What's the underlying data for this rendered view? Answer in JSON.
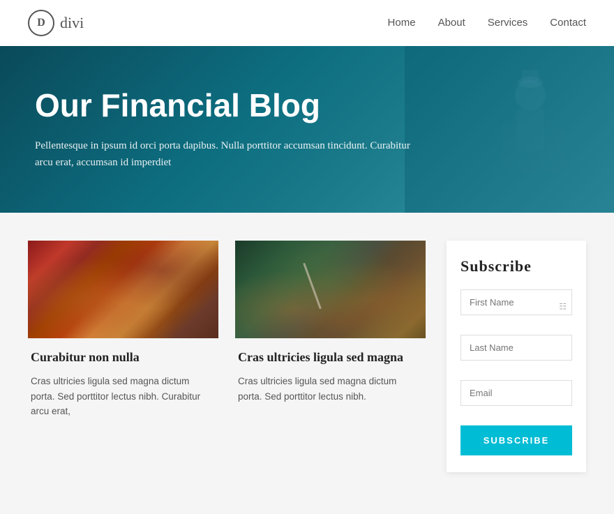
{
  "nav": {
    "logo_letter": "D",
    "logo_name": "divi",
    "links": [
      "Home",
      "About",
      "Services",
      "Contact"
    ]
  },
  "hero": {
    "title": "Our Financial Blog",
    "subtitle": "Pellentesque in ipsum id orci porta dapibus. Nulla porttitor accumsan tincidunt. Curabitur arcu erat, accumsan id imperdiet"
  },
  "posts": [
    {
      "id": 1,
      "image_type": "kitchen",
      "title": "Curabitur non nulla",
      "text": "Cras ultricies ligula sed magna dictum porta. Sed porttitor lectus nibh. Curabitur arcu erat,"
    },
    {
      "id": 2,
      "image_type": "bread",
      "title": "Cras ultricies ligula sed magna",
      "text": "Cras ultricies ligula sed magna dictum porta. Sed porttitor lectus nibh."
    }
  ],
  "subscribe": {
    "title": "Subscribe",
    "first_name_placeholder": "First Name",
    "last_name_placeholder": "Last Name",
    "email_placeholder": "Email",
    "button_label": "SUBSCRIBE"
  }
}
